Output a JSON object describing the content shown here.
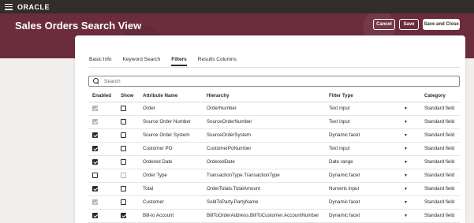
{
  "app": {
    "brand": "ORACLE"
  },
  "header": {
    "title": "Sales Orders Search View",
    "cancel_label": "Cancel",
    "save_label": "Save",
    "save_close_label": "Save and Close"
  },
  "tabs": [
    {
      "label": "Basic Info",
      "active": false
    },
    {
      "label": "Keyword Search",
      "active": false
    },
    {
      "label": "Filters",
      "active": true
    },
    {
      "label": "Results Columns",
      "active": false
    }
  ],
  "search": {
    "placeholder": "Search"
  },
  "table": {
    "columns": [
      "Enabled",
      "Show",
      "Attribute Name",
      "Hierarchy",
      "Filter Type",
      "Category"
    ],
    "rows": [
      {
        "enabled": true,
        "enabled_disabled": true,
        "show": false,
        "show_disabled": false,
        "attribute": "Order",
        "hierarchy": "OrderNumber",
        "filter_type": "Text input",
        "category": "Standard field"
      },
      {
        "enabled": true,
        "enabled_disabled": true,
        "show": false,
        "show_disabled": false,
        "attribute": "Source Order Number",
        "hierarchy": "SourceOrderNumber",
        "filter_type": "Text input",
        "category": "Standard field"
      },
      {
        "enabled": true,
        "enabled_disabled": false,
        "show": false,
        "show_disabled": false,
        "attribute": "Source Order System",
        "hierarchy": "SourceOrderSystem",
        "filter_type": "Dynamic facet",
        "category": "Standard field"
      },
      {
        "enabled": true,
        "enabled_disabled": false,
        "show": false,
        "show_disabled": false,
        "attribute": "Customer PO",
        "hierarchy": "CustomerPoNumber",
        "filter_type": "Text input",
        "category": "Standard field"
      },
      {
        "enabled": true,
        "enabled_disabled": false,
        "show": false,
        "show_disabled": false,
        "attribute": "Ordered Date",
        "hierarchy": "OrderedDate",
        "filter_type": "Date range",
        "category": "Standard field"
      },
      {
        "enabled": false,
        "enabled_disabled": false,
        "show": false,
        "show_disabled": true,
        "attribute": "Order Type",
        "hierarchy": "TransactionType.TransactionType",
        "filter_type": "Dynamic facet",
        "category": "Standard field"
      },
      {
        "enabled": true,
        "enabled_disabled": false,
        "show": false,
        "show_disabled": false,
        "attribute": "Total",
        "hierarchy": "OrderTotals.TotalAmount",
        "filter_type": "Numeric input",
        "category": "Standard field"
      },
      {
        "enabled": true,
        "enabled_disabled": true,
        "show": false,
        "show_disabled": false,
        "attribute": "Customer",
        "hierarchy": "SoldToParty.PartyName",
        "filter_type": "Dynamic facet",
        "category": "Standard field"
      },
      {
        "enabled": true,
        "enabled_disabled": false,
        "show": true,
        "show_disabled": false,
        "attribute": "Bill-to Account",
        "hierarchy": "BillToOrderAddress.BillToCustomer.AccountNumber",
        "filter_type": "Dynamic facet",
        "category": "Standard field"
      }
    ]
  }
}
